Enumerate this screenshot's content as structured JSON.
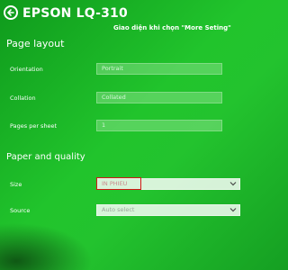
{
  "header": {
    "title": "EPSON LQ-310",
    "annotation": "Giao diện khi chọn \"More Seting\""
  },
  "page_layout": {
    "title": "Page layout",
    "rows": [
      {
        "label": "Orientation",
        "value": "Portrait"
      },
      {
        "label": "Collation",
        "value": "Collated"
      },
      {
        "label": "Pages per sheet",
        "value": "1"
      }
    ]
  },
  "paper_quality": {
    "title": "Paper and quality",
    "rows": [
      {
        "label": "Size",
        "value": "IN PHIEU"
      },
      {
        "label": "Source",
        "value": "Auto select"
      }
    ]
  },
  "icons": {
    "back": "back-arrow-icon",
    "chevron": "chevron-down-icon"
  },
  "colors": {
    "background": "#21c42c",
    "highlight": "#d21818"
  }
}
